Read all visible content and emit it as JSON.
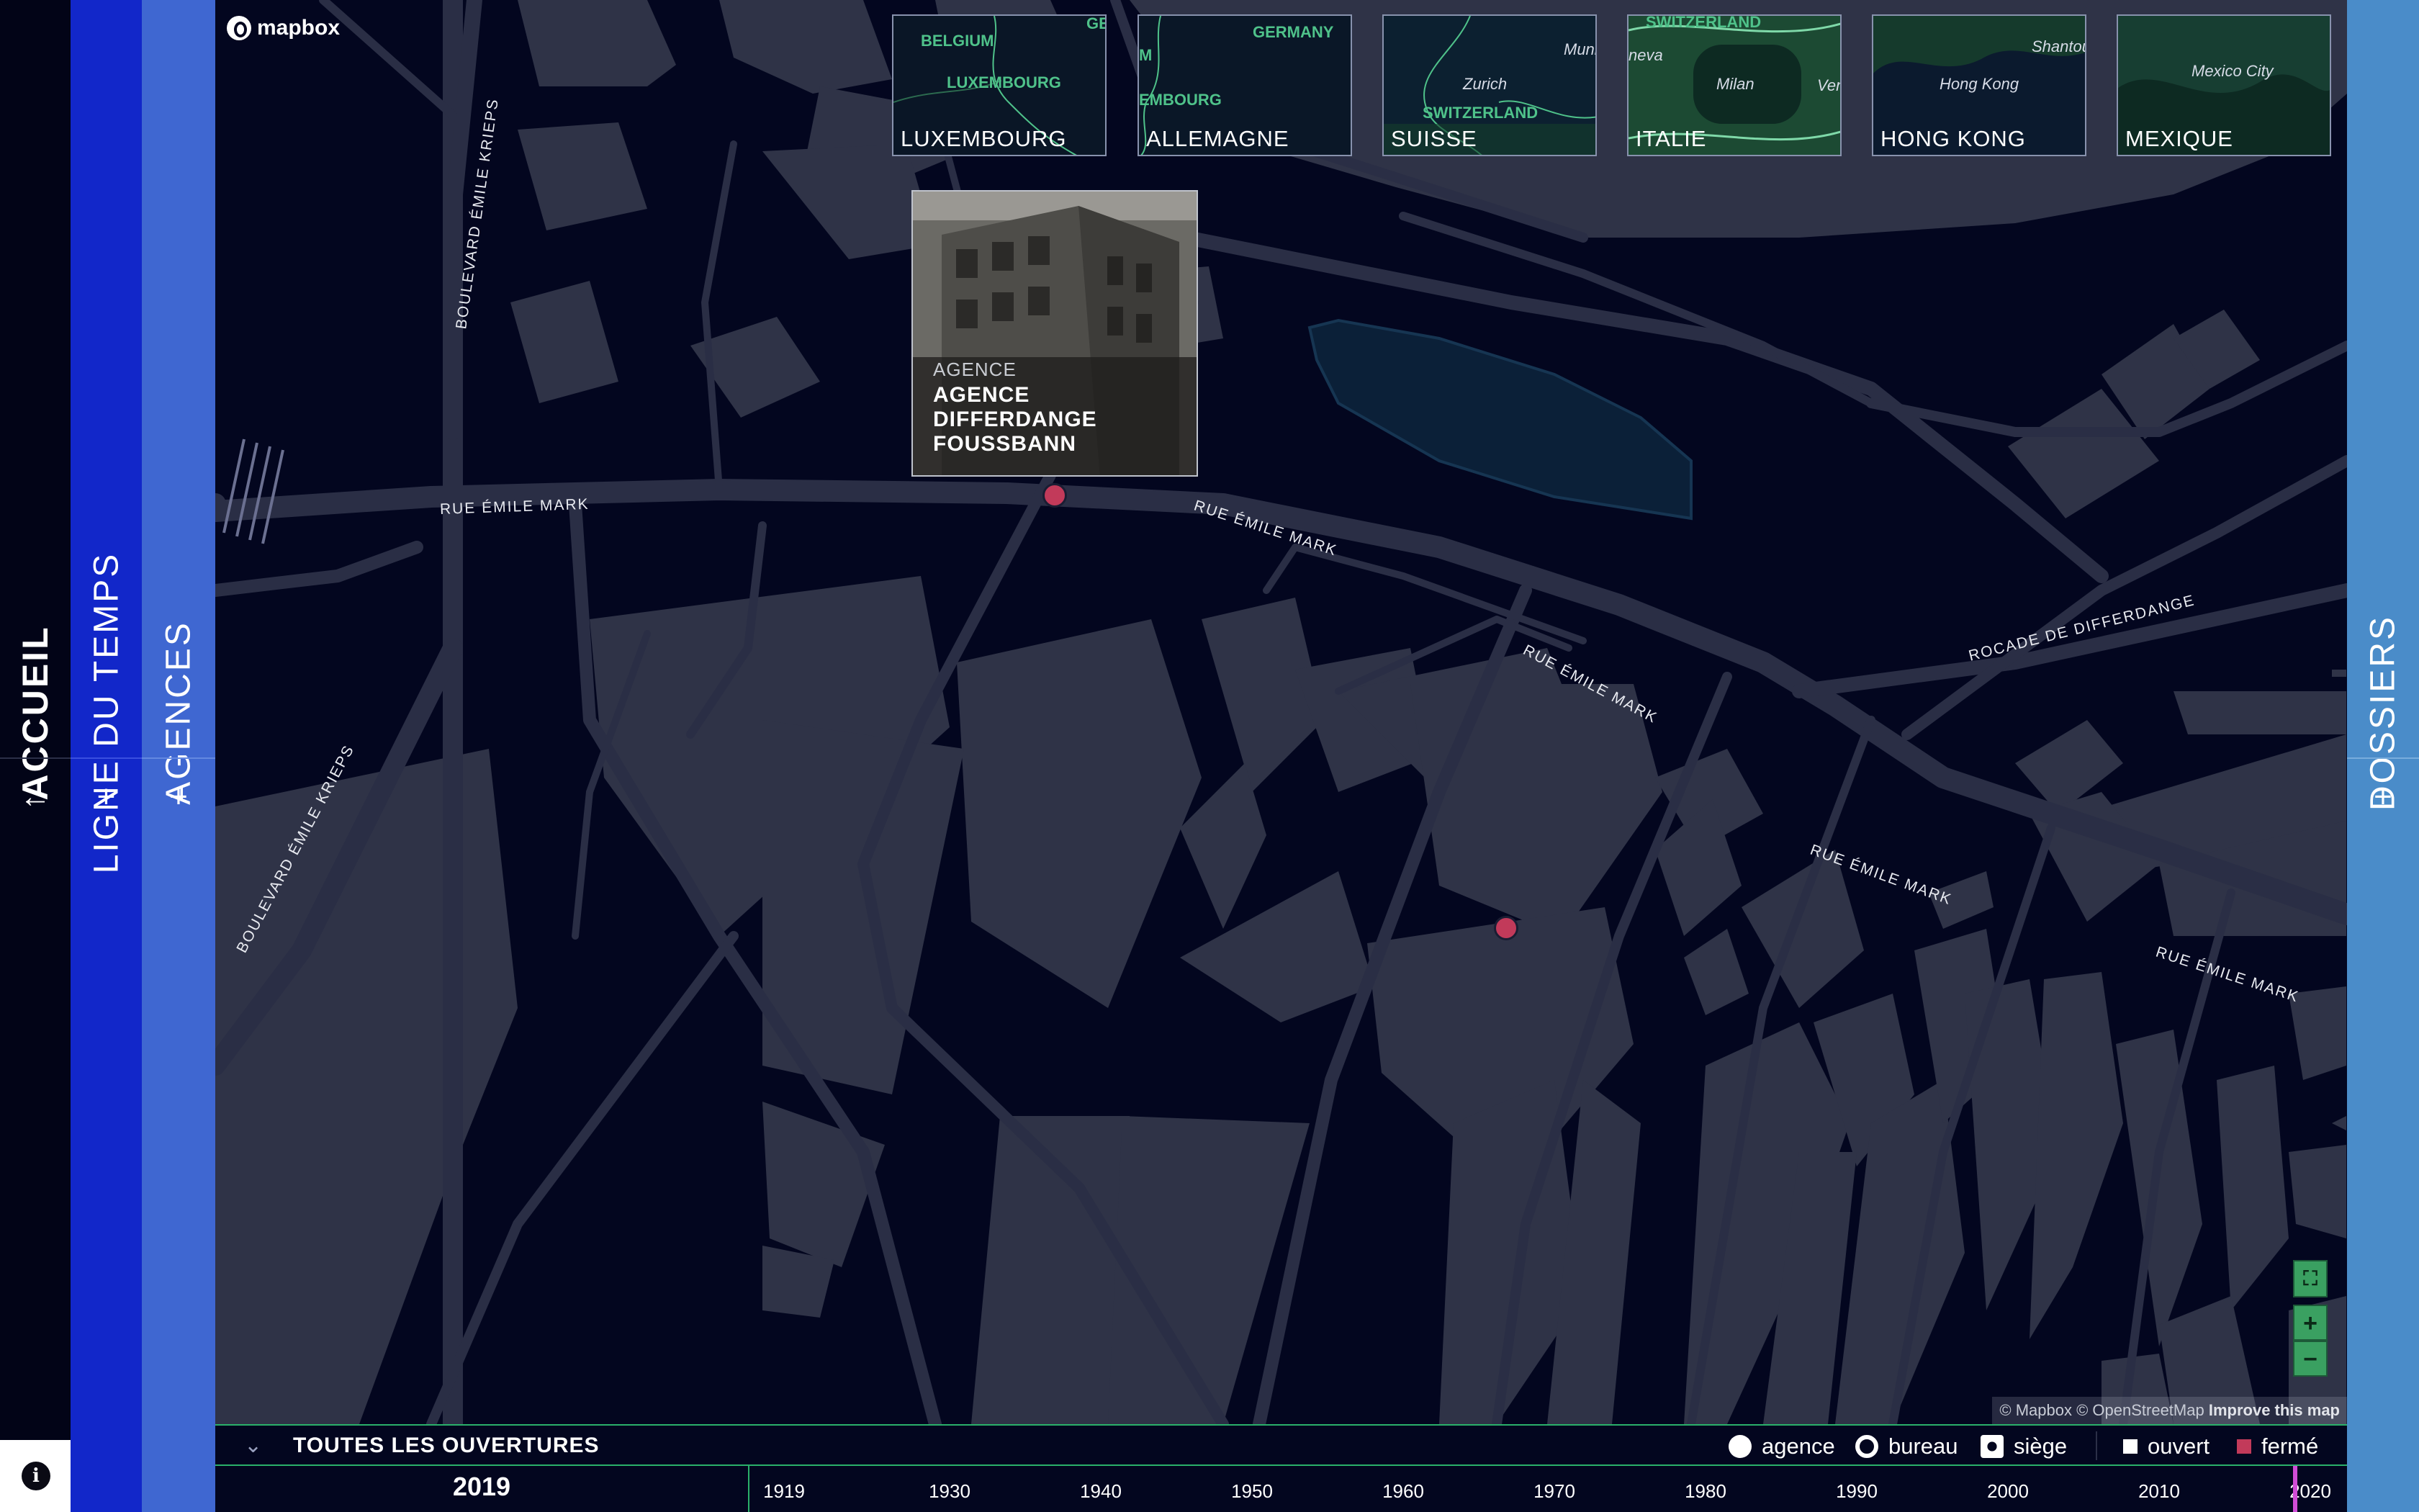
{
  "nav": {
    "accueil": "ACCUEIL",
    "accueil_glyph": "←",
    "ligne": "LIGNE DU TEMPS",
    "ligne_glyph": "+",
    "agences": "AGENCES",
    "agences_glyph": "+",
    "dossiers": "DOSSIERS",
    "dossiers_glyph": "+",
    "info_icon": "i"
  },
  "map": {
    "logo": "mapbox",
    "streets": {
      "s1": "RUE ÉMILE MARK",
      "s2": "RUE ÉMILE MARK",
      "s3": "RUE ÉMILE MARK",
      "s4": "RUE ÉMILE MARK",
      "s5": "RUE ÉMILE MARK",
      "s6": "BOULEVARD ÉMILE KRIEPS",
      "s7": "BOULEVARD ÉMILE KRIEPS",
      "s8": "ROCADE DE DIFFERDANGE"
    },
    "controls": {
      "zoom_in": "+",
      "zoom_out": "−"
    },
    "attribution": {
      "text": "© Mapbox © OpenStreetMap",
      "link": "Improve this map"
    }
  },
  "countries": [
    {
      "label": "LUXEMBOURG",
      "places": [
        "BELGIUM",
        "LUXEMBOURG",
        "GE"
      ]
    },
    {
      "label": "ALLEMAGNE",
      "places": [
        "GERMANY",
        "EMBOURG",
        "M"
      ]
    },
    {
      "label": "SUISSE",
      "places": [
        "Zurich",
        "SWITZERLAND",
        "Muni"
      ]
    },
    {
      "label": "ITALIE",
      "places": [
        "SWITZERLAND",
        "Milan",
        "neva",
        "Ven"
      ]
    },
    {
      "label": "HONG KONG",
      "places": [
        "Shantou",
        "Hong Kong"
      ]
    },
    {
      "label": "MEXIQUE",
      "places": [
        "Mexico City"
      ]
    }
  ],
  "popup": {
    "type": "AGENCE",
    "name_lines": [
      "AGENCE",
      "DIFFERDANGE",
      "FOUSSBANN"
    ]
  },
  "filter": {
    "title": "TOUTES LES OUVERTURES",
    "legend": {
      "agence": "agence",
      "bureau": "bureau",
      "siege": "siège",
      "ouvert": "ouvert",
      "ferme": "fermé"
    }
  },
  "timeline": {
    "current_year": "2019",
    "ticks": [
      "1919",
      "1930",
      "1940",
      "1950",
      "1960",
      "1970",
      "1980",
      "1990",
      "2000",
      "2010",
      "2020"
    ]
  },
  "colors": {
    "map_bg": "#03061f",
    "building": "#2f3347",
    "road": "#2a2e45",
    "marker": "#c23a5a",
    "accent_green": "#2ab06a"
  }
}
